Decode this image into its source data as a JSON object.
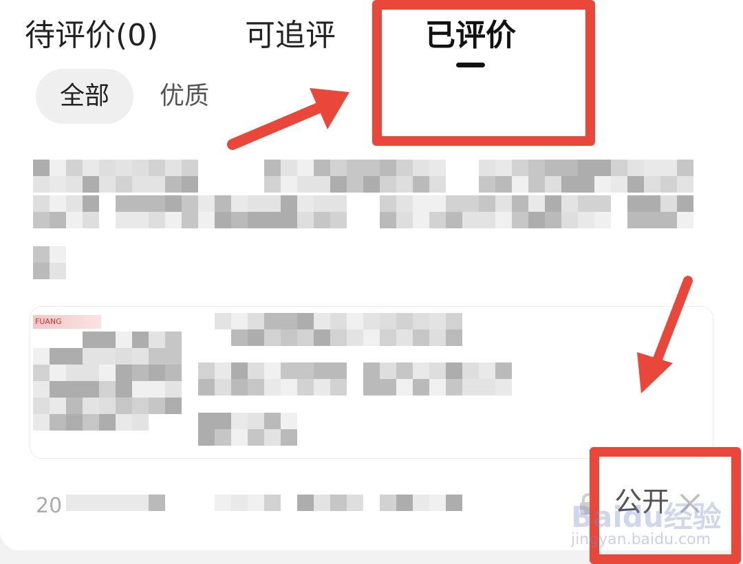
{
  "tabs": [
    {
      "label": "待评价(0)",
      "active": false
    },
    {
      "label": "可追评",
      "active": false
    },
    {
      "label": "已评价",
      "active": true
    }
  ],
  "filters": [
    {
      "label": "全部",
      "active": true
    },
    {
      "label": "优质",
      "active": false
    }
  ],
  "review": {
    "redacted": true
  },
  "product_card": {
    "logo_text": "FUANG",
    "redacted": true
  },
  "footer": {
    "date_prefix": "20",
    "privacy_label": "公开",
    "lock_icon": "lock-icon",
    "close_icon": "close-icon"
  },
  "annotations": {
    "color": "#e8473a"
  },
  "watermark": {
    "main": "Baidu经验",
    "sub": "jingyan.baidu.com"
  },
  "colors": {
    "accent": "#e8473a",
    "text_primary": "#222222",
    "chip_bg": "#efefef"
  }
}
